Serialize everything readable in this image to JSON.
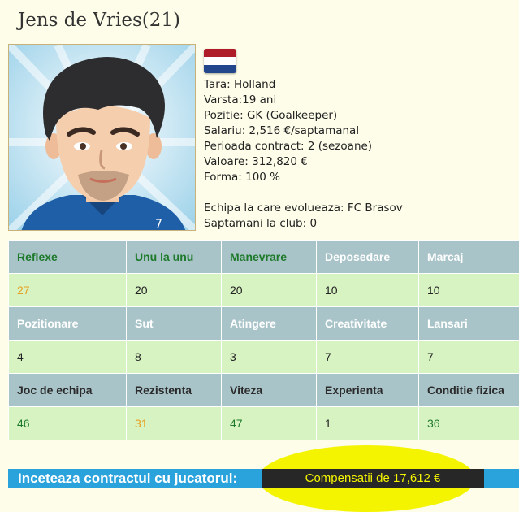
{
  "player": {
    "title": "Jens de Vries(21)",
    "avatar_icon": "player-avatar",
    "flag_icon": "netherlands-flag",
    "flag_colors": [
      "#ae1c28",
      "#ffffff",
      "#21468b"
    ]
  },
  "info": {
    "tara": "Tara: Holland",
    "varsta": "Varsta:19 ani",
    "pozitie": "Pozitie: GK (Goalkeeper)",
    "salariu": "Salariu: 2,516 €/saptamanal",
    "perioada": "Perioada contract: 2 (sezoane)",
    "valoare": "Valoare: 312,820 €",
    "forma": "Forma: 100 %",
    "echipa": "Echipa la care evolueaza: FC Brasov",
    "saptamani": "Saptamani la club: 0"
  },
  "stats": {
    "rows": [
      {
        "headers": [
          "Reflexe",
          "Unu la unu",
          "Manevrare",
          "Deposedare",
          "Marcaj"
        ],
        "values": [
          "27",
          "20",
          "20",
          "10",
          "10"
        ]
      },
      {
        "headers": [
          "Pozitionare",
          "Sut",
          "Atingere",
          "Creativitate",
          "Lansari"
        ],
        "values": [
          "4",
          "8",
          "3",
          "7",
          "7"
        ]
      },
      {
        "headers": [
          "Joc de echipa",
          "Rezistenta",
          "Viteza",
          "Experienta",
          "Conditie fizica"
        ],
        "values": [
          "46",
          "31",
          "47",
          "1",
          "36"
        ]
      }
    ]
  },
  "contract": {
    "label": "Inceteaza contractul cu jucatorul:",
    "button": "Compensatii de 17,612 €"
  },
  "colors": {
    "header_bg": "#a9c4c9",
    "value_bg": "#d8f3c2",
    "green_text": "#1d7a2a",
    "orange_text": "#e8a020",
    "bar_blue": "#2aa3dc",
    "highlight_yellow": "#f4f400"
  }
}
